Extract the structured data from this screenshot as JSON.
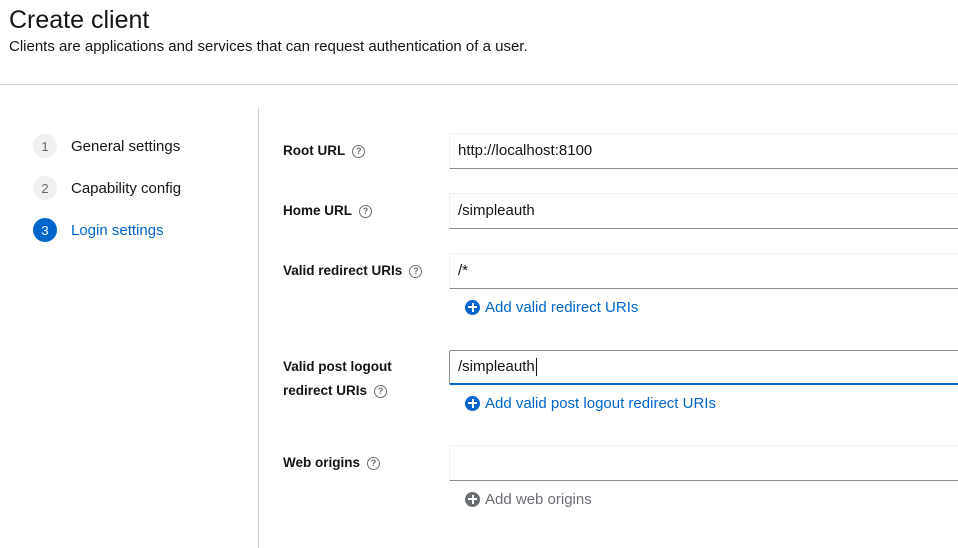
{
  "header": {
    "title": "Create client",
    "subtitle": "Clients are applications and services that can request authentication of a user."
  },
  "wizard": {
    "steps": [
      {
        "number": "1",
        "label": "General settings",
        "active": false
      },
      {
        "number": "2",
        "label": "Capability config",
        "active": false
      },
      {
        "number": "3",
        "label": "Login settings",
        "active": true
      }
    ]
  },
  "form": {
    "root_url": {
      "label": "Root URL",
      "value": "http://localhost:8100"
    },
    "home_url": {
      "label": "Home URL",
      "value": "/simpleauth"
    },
    "valid_redirect_uris": {
      "label": "Valid redirect URIs",
      "value": "/*",
      "add_label": "Add valid redirect URIs"
    },
    "valid_post_logout": {
      "label_line1": "Valid post logout",
      "label_line2": "redirect URIs",
      "value": "/simpleauth",
      "add_label": "Add valid post logout redirect URIs"
    },
    "web_origins": {
      "label": "Web origins",
      "value": "",
      "add_label": "Add web origins"
    },
    "help_glyph": "?"
  },
  "colors": {
    "accent": "#0066cc",
    "disabled": "#6a6e73",
    "divider": "#d2d2d2"
  },
  "icons": [
    "help-icon",
    "plus-circle-icon"
  ]
}
